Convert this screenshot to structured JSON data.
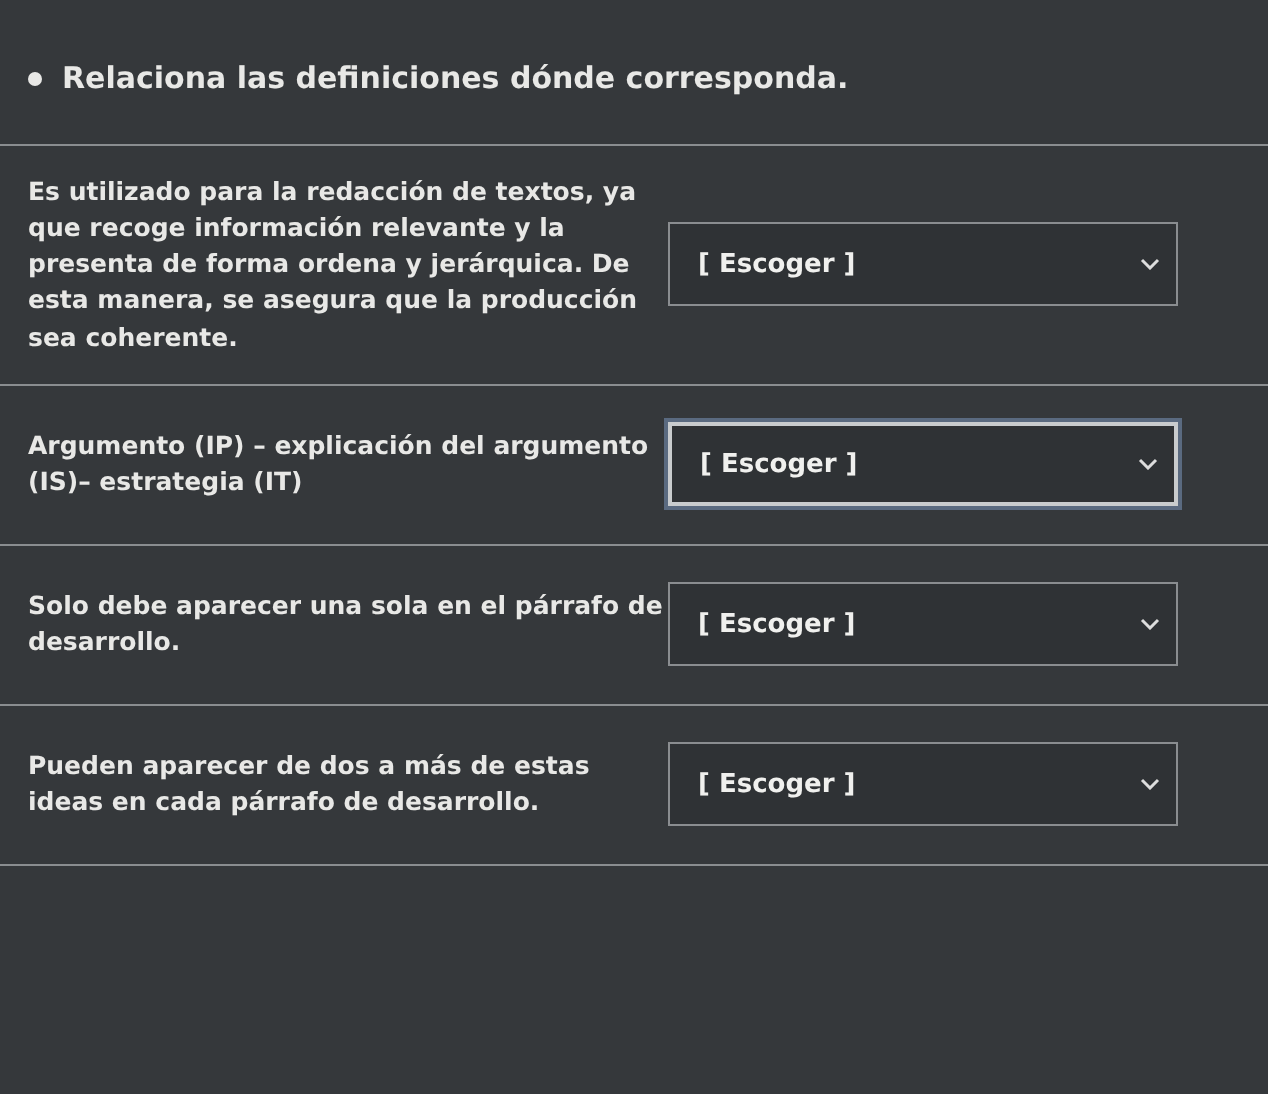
{
  "instruction": "Relaciona las definiciones dónde corresponda.",
  "rows": [
    {
      "definition": "Es utilizado para la redacción de textos, ya que recoge información relevante y la presenta de forma ordena y jerárquica. De esta manera, se asegura que la producción sea coherente.",
      "select": "[ Escoger ]",
      "focused": false
    },
    {
      "definition": "Argumento (IP) – explicación del argumento (IS)– estrategia (IT)",
      "select": "[ Escoger ]",
      "focused": true
    },
    {
      "definition": "Solo debe aparecer una sola en el párrafo de desarrollo.",
      "select": "[ Escoger ]",
      "focused": false
    },
    {
      "definition": "Pueden aparecer de dos a más de estas ideas en cada párrafo de desarrollo.",
      "select": "[ Escoger ]",
      "focused": false
    }
  ]
}
